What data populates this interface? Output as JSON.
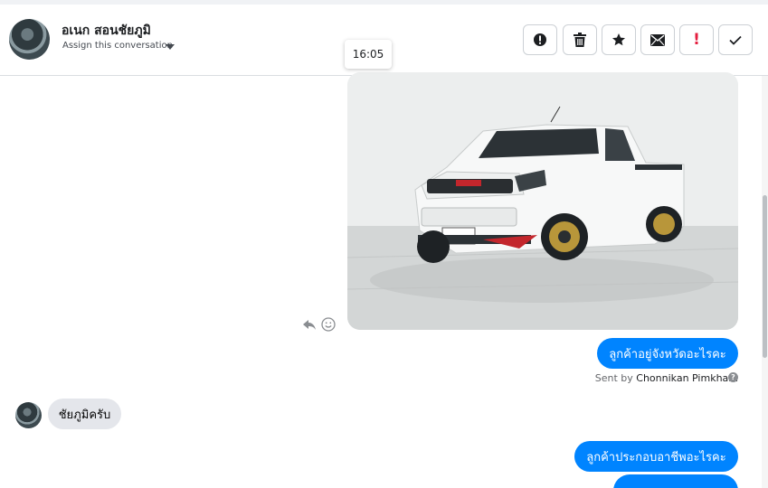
{
  "header": {
    "contact_name": "อเนก สอนชัยภูมิ",
    "assign_label": "Assign this conversation",
    "tooltip_time": "16:05"
  },
  "toolbar": {
    "buttons": [
      {
        "name": "mark-spam-button",
        "icon": "alert-circle-icon"
      },
      {
        "name": "delete-button",
        "icon": "trash-icon"
      },
      {
        "name": "star-button",
        "icon": "star-icon"
      },
      {
        "name": "mark-unread-button",
        "icon": "envelope-icon"
      },
      {
        "name": "follow-up-button",
        "icon": "exclamation-icon",
        "label": "!",
        "color": "#e41e3f"
      },
      {
        "name": "mark-done-button",
        "icon": "check-icon"
      }
    ]
  },
  "messages": {
    "outgoing_1": "ลูกค้าอยู่จังหวัดอะไรคะ",
    "sent_by_prefix": "Sent by",
    "sent_by_name": "Chonnikan Pimkham",
    "incoming_1": "ชัยภูมิครับ",
    "outgoing_2": "ลูกค้าประกอบอาชีพอะไรคะ"
  },
  "colors": {
    "outgoing_bubble": "#0084ff",
    "incoming_bubble": "#e4e6eb",
    "follow_up": "#e41e3f"
  }
}
